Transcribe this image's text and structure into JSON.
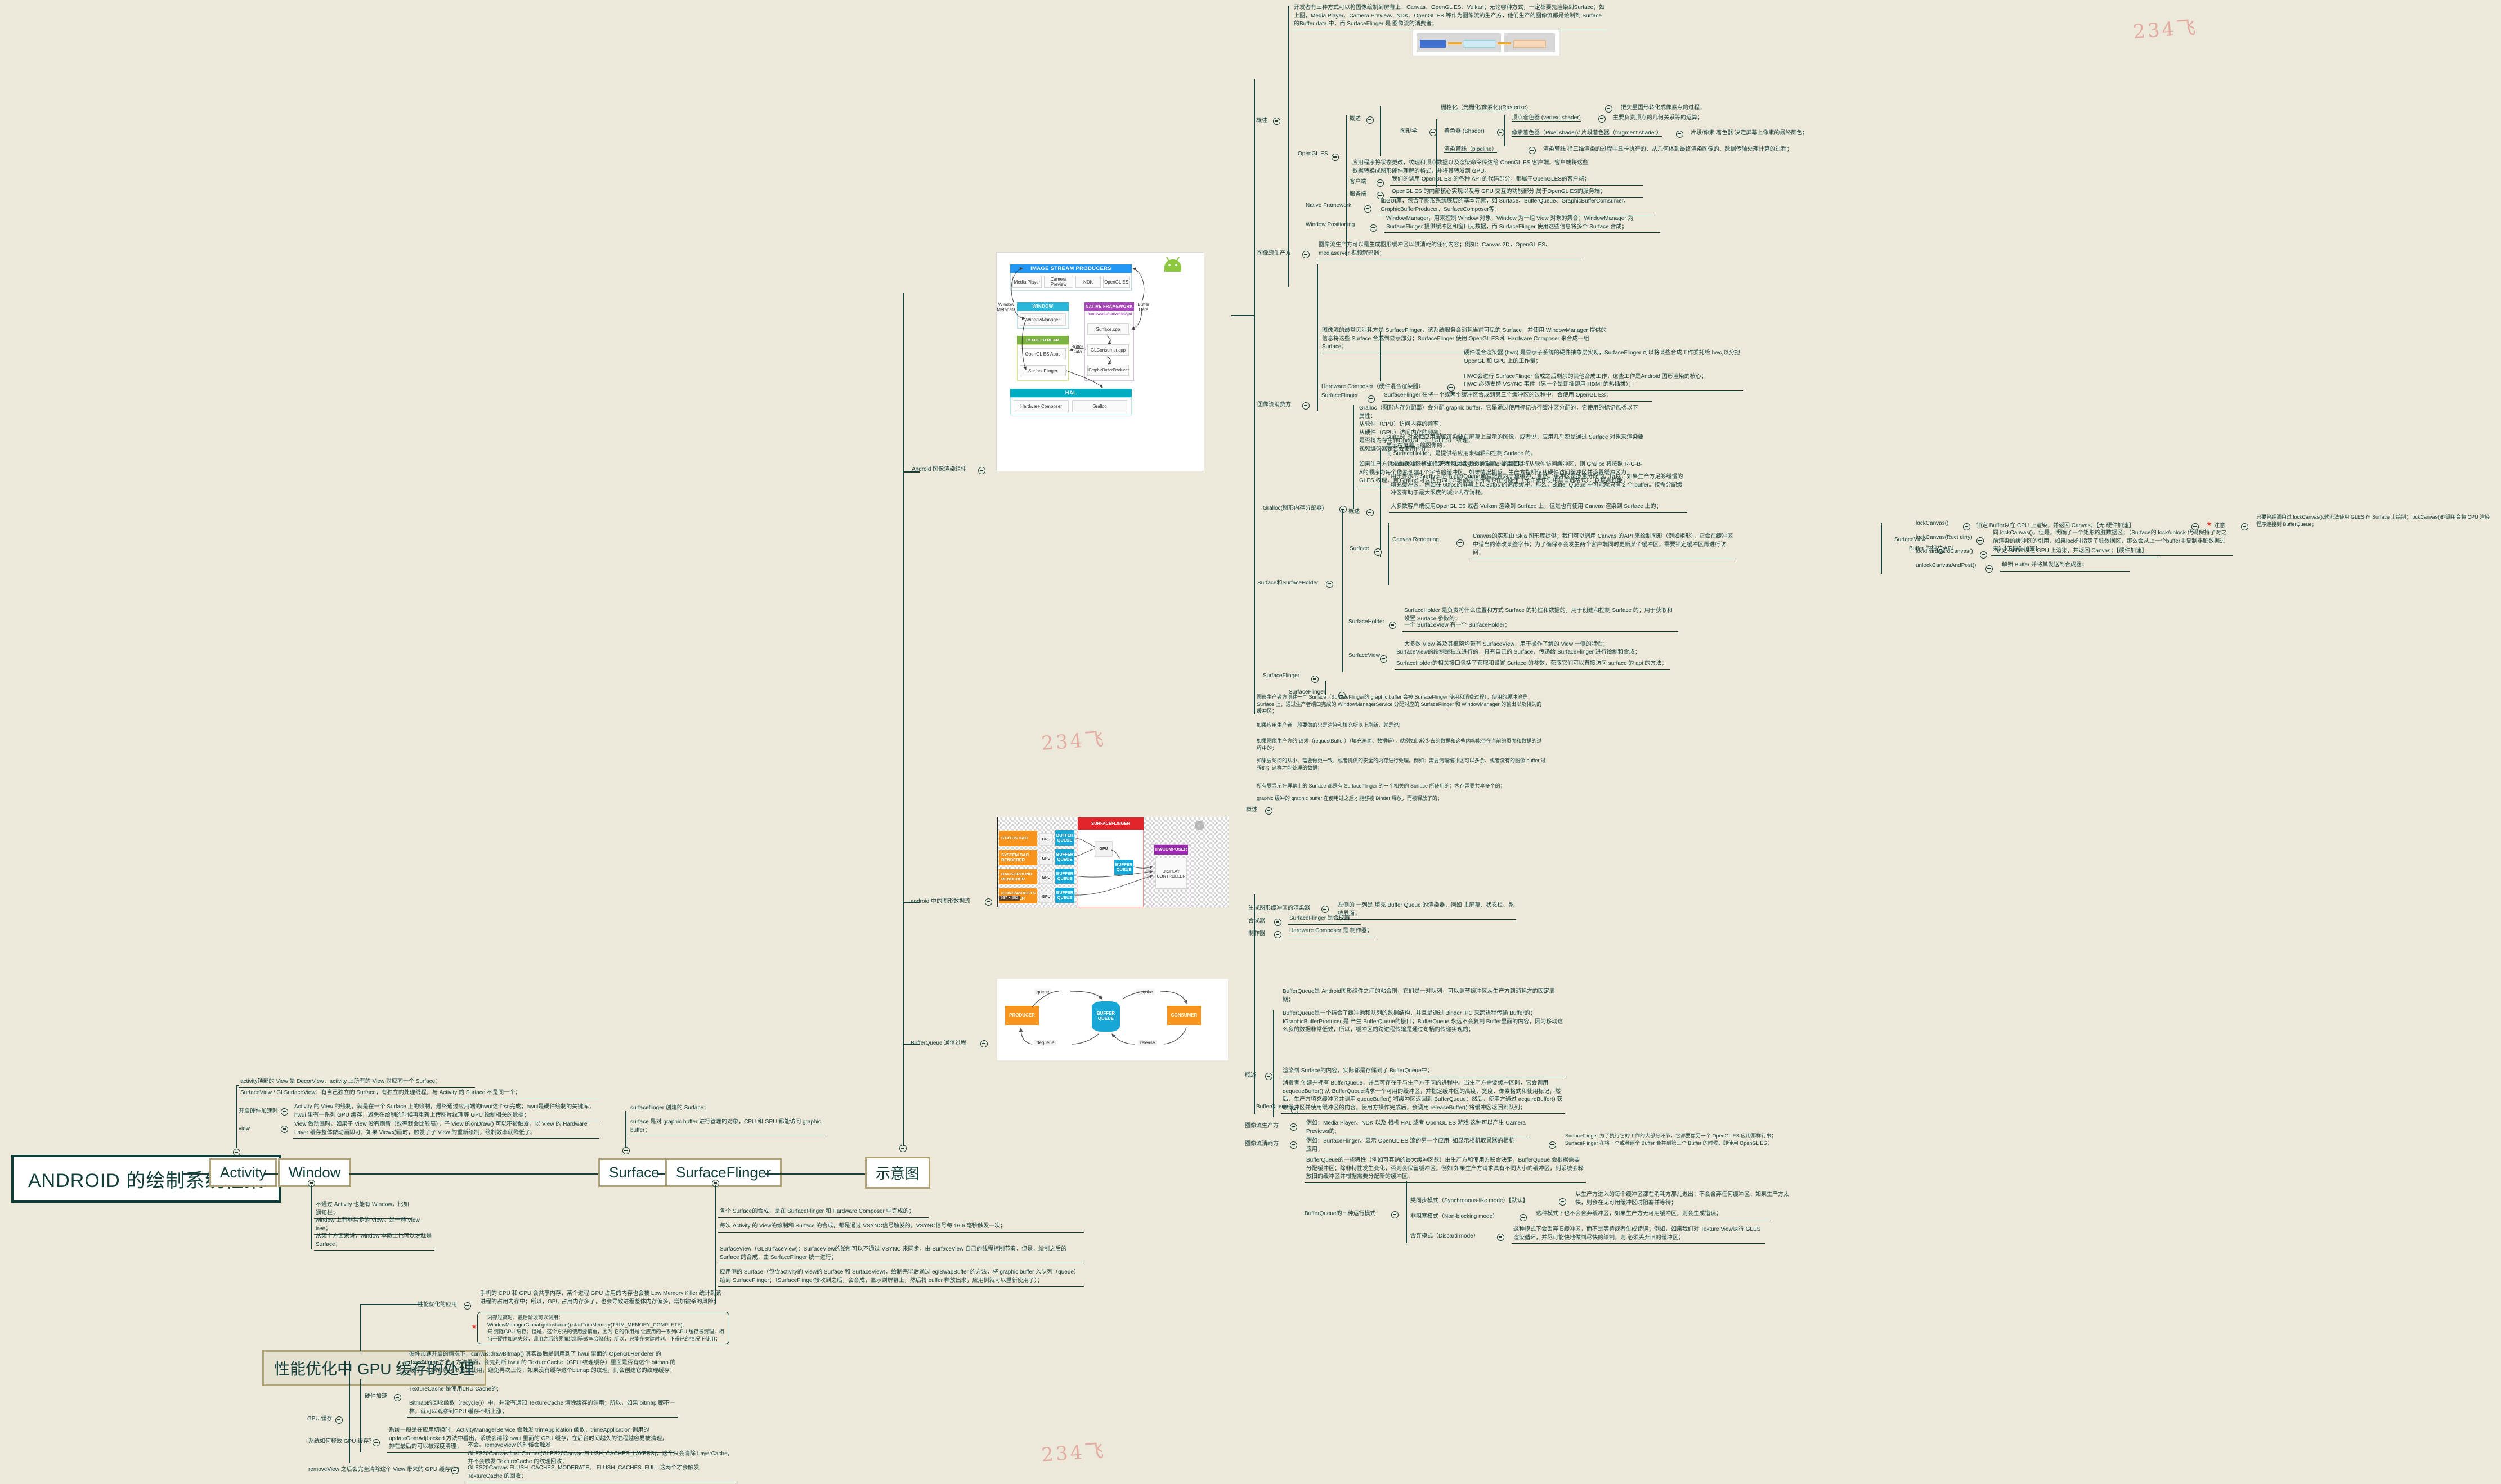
{
  "root": {
    "label": "ANDROID 的绘制系统框架"
  },
  "watermarks": [
    "234飞",
    "234飞",
    "234飞"
  ],
  "branches": {
    "activity": {
      "label": "Activity"
    },
    "window": {
      "label": "Window"
    },
    "surface": {
      "label": "Surface"
    },
    "surfaceflinger": {
      "label": "SurfaceFlinger"
    },
    "diagram": {
      "label": "示意图"
    },
    "gpu_cache": {
      "label": "性能优化中 GPU 缓存的处理"
    }
  },
  "activity_notes": [
    "activity顶部的 View 是 DecorView，activity 上所有的 View 对应同一个 Surface；",
    "SurfaceView / GLSurfaceView：有自己独立的 Surface，有独立的处理线程，与 Activity 的 Surface 不是同一个；"
  ],
  "activity_sub": [
    {
      "label": "开启硬件加速时",
      "text": "Activity 的 View 的绘制，就是在一个 Surface 上的绘制，最终通过应用端的hwui这个so完成；hwui是硬件绘制的关键库，hwui 里有一系列 GPU 缓存，避免在绘制的时候再重新上传图片纹理等 GPU 绘制相关的数据；"
    },
    {
      "label": "view",
      "text": "View 做动画时，如果子 View 没有刷新（效率就会比较高），子 View 的onDraw() 可以不被触发，以 View 的 Hardware Layer 缓存整体做动画即可；如果 View动画时，触发了子 View 的重新绘制，绘制效率就降低了。"
    }
  ],
  "window_notes": [
    "不通过 Activity 也能有 Window，比如通知栏；",
    "window 上有非常多的 View，是一颗 View tree；",
    "从某个方面来说，window 本质上也可以说就是 Surface；"
  ],
  "surface_notes": [
    "surfaceflinger 创建的 Surface；",
    "surface 是对 graphic buffer 进行管理的对象，CPU 和 GPU 都能访问 graphic buffer；"
  ],
  "surfaceflinger_notes": [
    "各个 Surface的合成，是在 SurfaceFlinger 和 Hardware Composer 中完成的；",
    "每次 Activity 的 View的绘制和 Surface 的合成，都是通过 VSYNC信号触发的，VSYNC信号每 16.6 毫秒触发一次；",
    "SurfaceView（GLSurfaceView)：SurfaceView的绘制可以不通过 VSYNC 来同步，由 SurfaceView 自己的线程控制节奏，但是，绘制之后的 Surface 的合成，由 SurfaceFlinger 统一进行；",
    "应用侧的 Surface（包含activity的 View的 Surface 和 SurfaceView)，绘制完毕后通过 eglSwapBuffer 的方法，将 graphic buffer 入队列（queue）给到 SurfaceFlinger；（SurfaceFlinger接收到之后，会合成，显示到屏幕上，然后将 buffer 释放出来，应用侧就可以重新使用了）；"
  ],
  "gpu_cache_tree": {
    "apply": {
      "label": "性能优化的应用",
      "notes": [
        "手机的 CPU 和 GPU 会共享内存，某个进程 GPU 占用的内存也会被 Low Memory Killer 统计到该进程的占用内存中；所以，GPU 占用内存多了，也会导致进程整体内存偏多，增加被杀的风险；"
      ],
      "boxed": "内存过高时，最后阶段可以调用：\nWindowManagerGlobal.getInstance().startTrimMemory(TRIM_MEMORY_COMPLETE);\n来 清除GPU 缓存；但是，这个方法的使用要慎重，因为 它的作用是 让应用的一系列GPU 缓存被清理，相当于硬件加速失效，调用之后的界面绘制等效率会降低；所以，只能在关键时刻、不得已的情况下使用；"
    },
    "gpu_cache": {
      "label": "GPU 缓存",
      "hw_accel": {
        "label": "硬件加速",
        "notes": [
          "硬件加速开启的情况下，canvas.drawBitmap() 其实最后是调用到了 hwui 里面的 OpenGLRenderer 的 drawBitmap方法，方法里面，会先判断 hwui 的 TextureCache（GPU 纹理缓存）里面是否有这个 bitmap 的缓存，如果有就可以直接使用，避免再次上传；如果没有缓存这个bitmap 的纹理，则会创建它的纹理缓存；",
          "TextureCache 是使用LRU Cache的;",
          "Bitmap的回收函数（recycle()）中，并没有通知 TextureCache 清除缓存的调用；所以，如果 bitmap 都不一样，就可以观察到GPU 缓存不断上涨；"
        ]
      },
      "release": {
        "label": "系统如何释放 GPU 缓存？",
        "text": "系统一般是在应用切换时，ActivityManagerService 会触发 trimApplication 函数，trimeApplication 调用的 updateOomAdjLocked 方法中看出，系统会清除 hwui 里面的 GPU 缓存，在后台时间越久的进程越容易被清理，排在最后的可以被深度清理；"
      },
      "removeview": {
        "label": "removeView 之后会完全清除这个 View 带来的 GPU 缓存吗?",
        "notes": [
          "不会。removeView 的时候会触发 GLES20Canvas.flushCaches(GLES20Canvas.FLUSH_CACHES_LAYERS)，这个只会清除 LayerCache，并不会触发 TextureCache 的纹理回收；",
          "GLES20Canvas.FLUSH_CACHES_MODERATE、 FLUSH_CACHES_FULL 这两个才会触发 TextureCache 的回收；"
        ]
      }
    }
  },
  "diagram_children": [
    {
      "label": "Android 图像渲染组件"
    },
    {
      "label": "android 中的图形数据流"
    },
    {
      "label": "BufferQueue 通信过程"
    }
  ],
  "diagram1": {
    "title_producers": "IMAGE STREAM PRODUCERS",
    "producers": [
      "Media Player",
      "Camera Preview",
      "NDK",
      "OpenGL ES"
    ],
    "window_positioning": "WINDOW POSITIONING",
    "window_manager": "WindowManager",
    "native_framework": "NATIVE FRAMEWORK",
    "native_path": "frameworks/native/libs/gui",
    "native_boxes": [
      "Surface.cpp",
      "GLConsumer.cpp",
      "IGraphicBufferProducer"
    ],
    "consumers_title": "IMAGE STREAM CONSUMERS",
    "consumers": [
      "OpenGL ES Apps",
      "SurfaceFlinger"
    ],
    "hal_title": "HAL",
    "hal_boxes": [
      "Hardware Composer",
      "Gralloc"
    ],
    "edge_labels": [
      "Window\nMetadata",
      "Buffer\nData",
      "Buffer\nData"
    ]
  },
  "diagram2": {
    "renderers": [
      "STATUS BAR",
      "SYSTEM BAR RENDERER",
      "BACKGROUND RENDERER",
      "ICONS/WIDGETS RENDERER"
    ],
    "gpu": "GPU",
    "buffer_queue": "BUFFER QUEUE",
    "surfaceflinger": "SURFACEFLINGER",
    "hwcomposer": "HWCOMPOSER",
    "display_controller": "DISPLAY CONTROLLER",
    "size_badge": "537 × 262"
  },
  "diagram3": {
    "producer": "PRODUCER",
    "consumer": "CONSUMER",
    "buffer_queue": "BUFFER QUEUE",
    "ops": [
      "queue",
      "acquire",
      "dequeue",
      "release"
    ]
  },
  "opengl_tree": {
    "overview_label": "概述",
    "intro": "开发者有三种方式可以将图像绘制到屏幕上：Canvas、OpenGL ES、Vulkan；无论哪种方式，一定都要先渲染到Surface；如上图，Media Player、Camera Preview、NDK、OpenGL ES 等作为图像流的生产方，他们生产的图像流都是绘制到 Surface 的Buffer data 中，而 SurfaceFlinger 是 图像流的消费者；",
    "opengl_label": "OpenGL ES",
    "gl_overview_label": "概述",
    "rasterize": {
      "label": "栅格化（光栅化/像素化)(Rasterize)",
      "text": "把矢量图形转化成像素点的过程；"
    },
    "graphics_label": "图形学",
    "shader_label": "着色器 (Shader)",
    "shaders": [
      {
        "label": "顶点着色器 (vertext shader)",
        "text": "主要负责顶点的几何关系等的运算；"
      },
      {
        "label": "像素着色器（Pixel shader)/ 片段着色器（fragment shader）",
        "text": "片段/像素 着色器 决定屏幕上像素的最终颜色；"
      }
    ],
    "pipeline": {
      "label": "渲染管线（pipeline）",
      "text": "渲染管线 指三维渲染的过程中显卡执行的、从几何体到最终渲染图像的、数据传输处理计算的过程；"
    },
    "pipeline_note": "应用程序将状态更改，纹理和顶点数据以及渲染命令传达给 OpenGL ES 客户端。客户端将这些数据转换成图形硬件理解的格式，并将其转发到 GPU。",
    "client": {
      "label": "客户端",
      "text": "我们的调用 OpenGL ES 的各种 API 的代码部分，都属于OpenGLES的客户端；"
    },
    "server": {
      "label": "服务端",
      "text": "OpenGL ES 的内部核心实现以及与 GPU 交互的功能部分 属于OpenGL ES的服务端；"
    },
    "native_framework": {
      "label": "Native Framework",
      "text": "libGUI库，包含了图形系统底层的基本元素，如 Surface、BufferQueue、GraphicBufferComsumer、GraphicBufferProducer、SurfaceComposer等；"
    },
    "window_positioning": {
      "label": "Window Positioning",
      "text": "WindowManager，用来控制 Window 对象，Window 为一组 View 对象的集合；WindowManager 为 SurfaceFlinger 提供缓冲区和窗口元数据，而 SurfaceFlinger 使用这些信息将多个 Surface 合成；"
    },
    "producer": {
      "label": "图像流生产方",
      "text": "图像流生产方可以是生成图形缓冲区以供消耗的任何内容；例如：Canvas 2D，OpenGL ES、mediaserver 视频解码器；"
    },
    "consumer_label": "图像流消费方",
    "consumer_note": "图像流的最常见消耗方是 SurfaceFlinger，该系统服务会消耗当前可见的 Surface，并使用 WindowManager 提供的信息将这些 Surface 合成到显示部分；SurfaceFlinger 使用 OpenGL ES 和 Hardware Composer 来合成一组 Surface；",
    "hwc": {
      "label": "Hardware Composer（硬件混合渲染器）",
      "notes": [
        "硬件混合渲染器 (hwc) 是显示子系统的硬件抽象层实现，SurfaceFlinger 可以将某些合成工作委托给 hwc,以分担 OpenGL 和 GPU 上的工作量；",
        "HWC会进行 SurfaceFlinger 合成之后剩余的其他合成工作，这些工作是Android 图形渲染的核心；",
        "HWC 必须支持 VSYNC 事件（另一个是即插即用 HDMI 的热插拔）；"
      ]
    },
    "sf": {
      "label": "SurfaceFlinger",
      "text": "SurfaceFlinger 在将一个或两个缓冲区合成到第三个缓冲区的过程中，会使用 OpenGL ES；"
    },
    "gralloc": {
      "label": "Gralloc(图形内存分配器)",
      "notes": [
        "Gralloc（图形内存分配器）会分配 graphic buffer，它是通过使用标记执行缓冲区分配的，它使用的标记包括以下属性：\n从软件（CPU）访问内存的频率；\n从硬件（GPU）访问内存的频率；\n是否将内存用作OpenGL ES（GLES） 纹理；\n视频编码器是否会使用内存；",
        "如果生产方请求的缓冲区格式指定为 RGBA_8888 像素，并且指明将从软件访问缓冲区，则 Gralloc 将按照 R-G-B-A的顺序为每个像素创建4 个字节的缓冲区。如果情况相反，生产方指明仅从硬件访问缓冲区并设置缓冲区为 GLES 纹理，则 Gralloc 可以执行GLES驱动程序所需的任何操作（允许硬件使用其首选格式），以提高性能；"
      ]
    }
  },
  "surface_tree": {
    "label": "Surface和SurfaceHolder",
    "overview_label": "概述",
    "overview_notes": [
      "Surface 对象使应用能够渲染要在屏幕上显示的图像，或者说，应用几乎都是通过 Surface 对象来渲染要显示在屏幕上的图像的；\n而 SurfaceHolder，是提供给应用来编辑和控制 Surface 的。",
      "Surface 是一个让生产者和消费者交换 Buffer 的接口；",
      "用于显示的 Surface 的 BufferQueue通常配置为三重缓冲，当然，缓冲区是按需分配的，所以，如果生产方足够缓慢的填充缓冲区，例如在 60fps的屏幕上以 30fps 的速度缓冲，那么，Buffer Queue 中可能就只有 2 个 buffer。按需分配缓冲区有助于最大限度的减少内存消耗。",
      "大多数客户端使用OpenGL ES 或者 Vulkan 渲染到 Surface 上，但是也有使用 Canvas 渲染到 Surface 上的；"
    ],
    "surface_label": "Surface",
    "canvas_rendering": {
      "label": "Canvas Rendering",
      "text": "Canvas的实现由 Skia 图形库提供；我们可以调用 Canvas 的API 来绘制图形（例如矩形），它会在缓冲区中适当的修改某些字节；为了确保不会发生两个客户端同时更新某个缓冲区，需要锁定缓冲区再进行访问；"
    },
    "surfaceholder": {
      "label": "SurfaceHolder",
      "notes": [
        "SurfaceHolder 是负责将什么位置和方式 Surface 的特性和数据的，用于创建和控制 Surface 的；用于获取和设置 Surface 参数的；",
        "一个 SurfaceView 有一个 SurfaceHolder；"
      ]
    },
    "surfaceview_note": "大多数 View 类及其框架均带有 SurfaceView，用于操作了解的 View 一侧的特性；",
    "surfaceview_label": "SurfaceView",
    "sv_notes": [
      "SurfaceView的绘制是独立进行的，具有自己的 Surface，传递给 SurfaceFlinger 进行绘制和合成；",
      "SurfaceHolder的相关接口包括了获取和设置 Surface 的参数，获取它们可以直接访问 surface 的 api 的方法；"
    ],
    "sf_label": "SurfaceFlinger",
    "sf_notes": [
      "图形生产者方创建一个 Surface（SurfaceFlinger的 graphic buffer 会被 SurfaceFlinger 使用和消费过程），使用的缓冲池是 Surface 上，通过生产者端口完成的 WindowManagerService 分配对应的 SurfaceFlinger 和 WindowManager 的输出以及相关的缓冲区；",
      "如果应用生产者一般要做的只是渲染和填充所以上刷新，就是说；",
      "如果图像生产方的 请求（requestBuffer）（填充画面、数据等），就例如比较少去的数据和这些内容能否在当前的页面和数据的过程中的；",
      "如果要访问的从小、需要做更一致，或者提供的安全的内存进行处理。例如：需要清理缓冲区可以多余、或者没有的图像 buffer 过程的；这样才能处理的数据；",
      "所有要显示在屏幕上的 Surface 都是有 SurfaceFlinger 的一个相关的 Surface 所使用的；内存需要共享多个的；",
      "graphic 缓冲的 graphic buffer 在使用过之后才能够被 Binder 释放，而被释放了的；"
    ],
    "lock_api": {
      "label": "Buffer 的相关 API",
      "lockCanvas": {
        "label": "lockCanvas()",
        "text": "锁定 Buffer以在 CPU 上渲染，并返回 Canvas；【无 硬件加速】",
        "note_label": "注意",
        "note": "只要曾经调用过 lockCanvas(),就无法使用 GLES 在 Surface 上绘制；lockCanvas()的调用会将 CPU 渲染程序连接到 BufferQueue；"
      },
      "lockCanvasRect": {
        "label": "lockCanvas(Rect dirty)",
        "text": "同 lockCanvas()，但是，明确了一个矩形的脏数据区；（Surface的 lock/unlock 代码保持了对之前渲染的缓冲区的引用，如果lock时指定了脏数据区，那么会从上一个buffer中复制非脏数据过来）【无硬件加速】"
      },
      "lockHardwardCanvas": {
        "label": "lockHardwardCanvas()",
        "text": "锁定 Buffer以在 GPU 上渲染，并返回 Canvas；【硬件加速】"
      },
      "unlockCanvasAndPost": {
        "label": "unlockCanvasAndPost()",
        "text": "解锁 Buffer 并将其发送到合成器；"
      }
    }
  },
  "bufferqueue_tree": {
    "label": "BufferQueue",
    "top_notes": [
      {
        "label": "生成图形缓冲区的渲染器",
        "text": "左侧的 一列是 填充 Buffer Queue 的渲染器，例如 主屏幕、状态栏、系统界面；"
      },
      {
        "label": "合成器",
        "text": "SurfaceFlinger 是合成器"
      },
      {
        "label": "制作器",
        "text": "Hardware Composer 是 制作器；"
      }
    ],
    "overview_label": "概述",
    "overview_notes": [
      "BufferQueue是 Android图形组件之间的粘合剂，它们是一对队列，可以调节缓冲区从生产方到消耗方的固定周期；",
      "BufferQueue是一个结合了缓冲池和队列的数据结构，并且是通过 Binder IPC 来跨进程传输 Buffer的；IGraphicBufferProducer 是 产生 BufferQueue的接口；BufferQueue 永远不会复制 Buffer里面的内容，因为移动这么多的数据非常低效，所以，缓冲区的跨进程传输是通过句柄的传递实现的；",
      "渲染到 Surface的内容，实际都是存储到了 BufferQueue中；",
      "消费者 创建并拥有 BufferQueue，并且可存在于与生产方不同的进程中。当生产方需要缓冲区时，它会调用 dequeueBuffer() 从 BufferQueue请求一个可用的缓冲区，并指定缓冲区的高度、宽度、像素格式和使用标记，然后，生产方填充缓冲区并调用 queueBuffer() 将缓冲区返回到 BufferQueue；然后，使用方通过 acquireBuffer() 获取缓冲区并使用缓冲区的内容，使用方操作完成后，会调用 releaseBuffer() 将缓冲区返回到队列；"
    ],
    "producer": {
      "label": "图像流生产方",
      "text": "例如：Media Player、NDK 以及 相机 HAL 或者 OpenGL ES 游戏 这种可以产生 Camera Previews的;"
    },
    "consumer": {
      "label": "图像流消耗方",
      "text": "例如：SurfaceFlinger、显示 OpenGL ES 流的另一个应用: 如显示相机取景器的相机应用；",
      "note": "SurfaceFlinger 为了执行它的工作的大部分环节，它都要像另一个 OpenGL ES 应用那样行事；\nSurfaceFlinger 在将一个或者两个 Buffer 合并到第三个 Buffer 的时候，即使用 OpenGL ES；"
    },
    "bq_notes": [
      "BufferQueue的一些特性（例如可容纳的最大缓冲区数）由生产方和使用方联合决定，BufferQueue 会根据需要分配缓冲区；除非特性发生变化，否则会保留缓冲区，例如 如果生产方请求具有不同大小的缓冲区，则系统会释放旧的缓冲区并根据需要分配新的缓冲区；"
    ],
    "modes_label": "BufferQueue的三种运行模式",
    "modes": [
      {
        "label": "类同步模式（Synchronous-like mode）【默认】",
        "text": "从生产方进入的每个缓冲区都在消耗方那儿退出；不会舍弃任何缓冲区；如果生产方太快，则会在无可用缓冲区时阻塞并等待；"
      },
      {
        "label": "非阻塞模式（Non-blocking mode）",
        "text": "这种模式下也不会舍弃缓冲区，如果生产方无可用缓冲区，则会生成错误；"
      },
      {
        "label": "舍弃模式（Discard mode）",
        "text": "这种模式下会丢弃旧缓冲区，而不是等待或者生成错误；例如，如果我们对 Texture View执行 GLES 渲染循环，并尽可能快地做到尽快的绘制，则 必须丢弃旧的缓冲区；"
      }
    ]
  }
}
